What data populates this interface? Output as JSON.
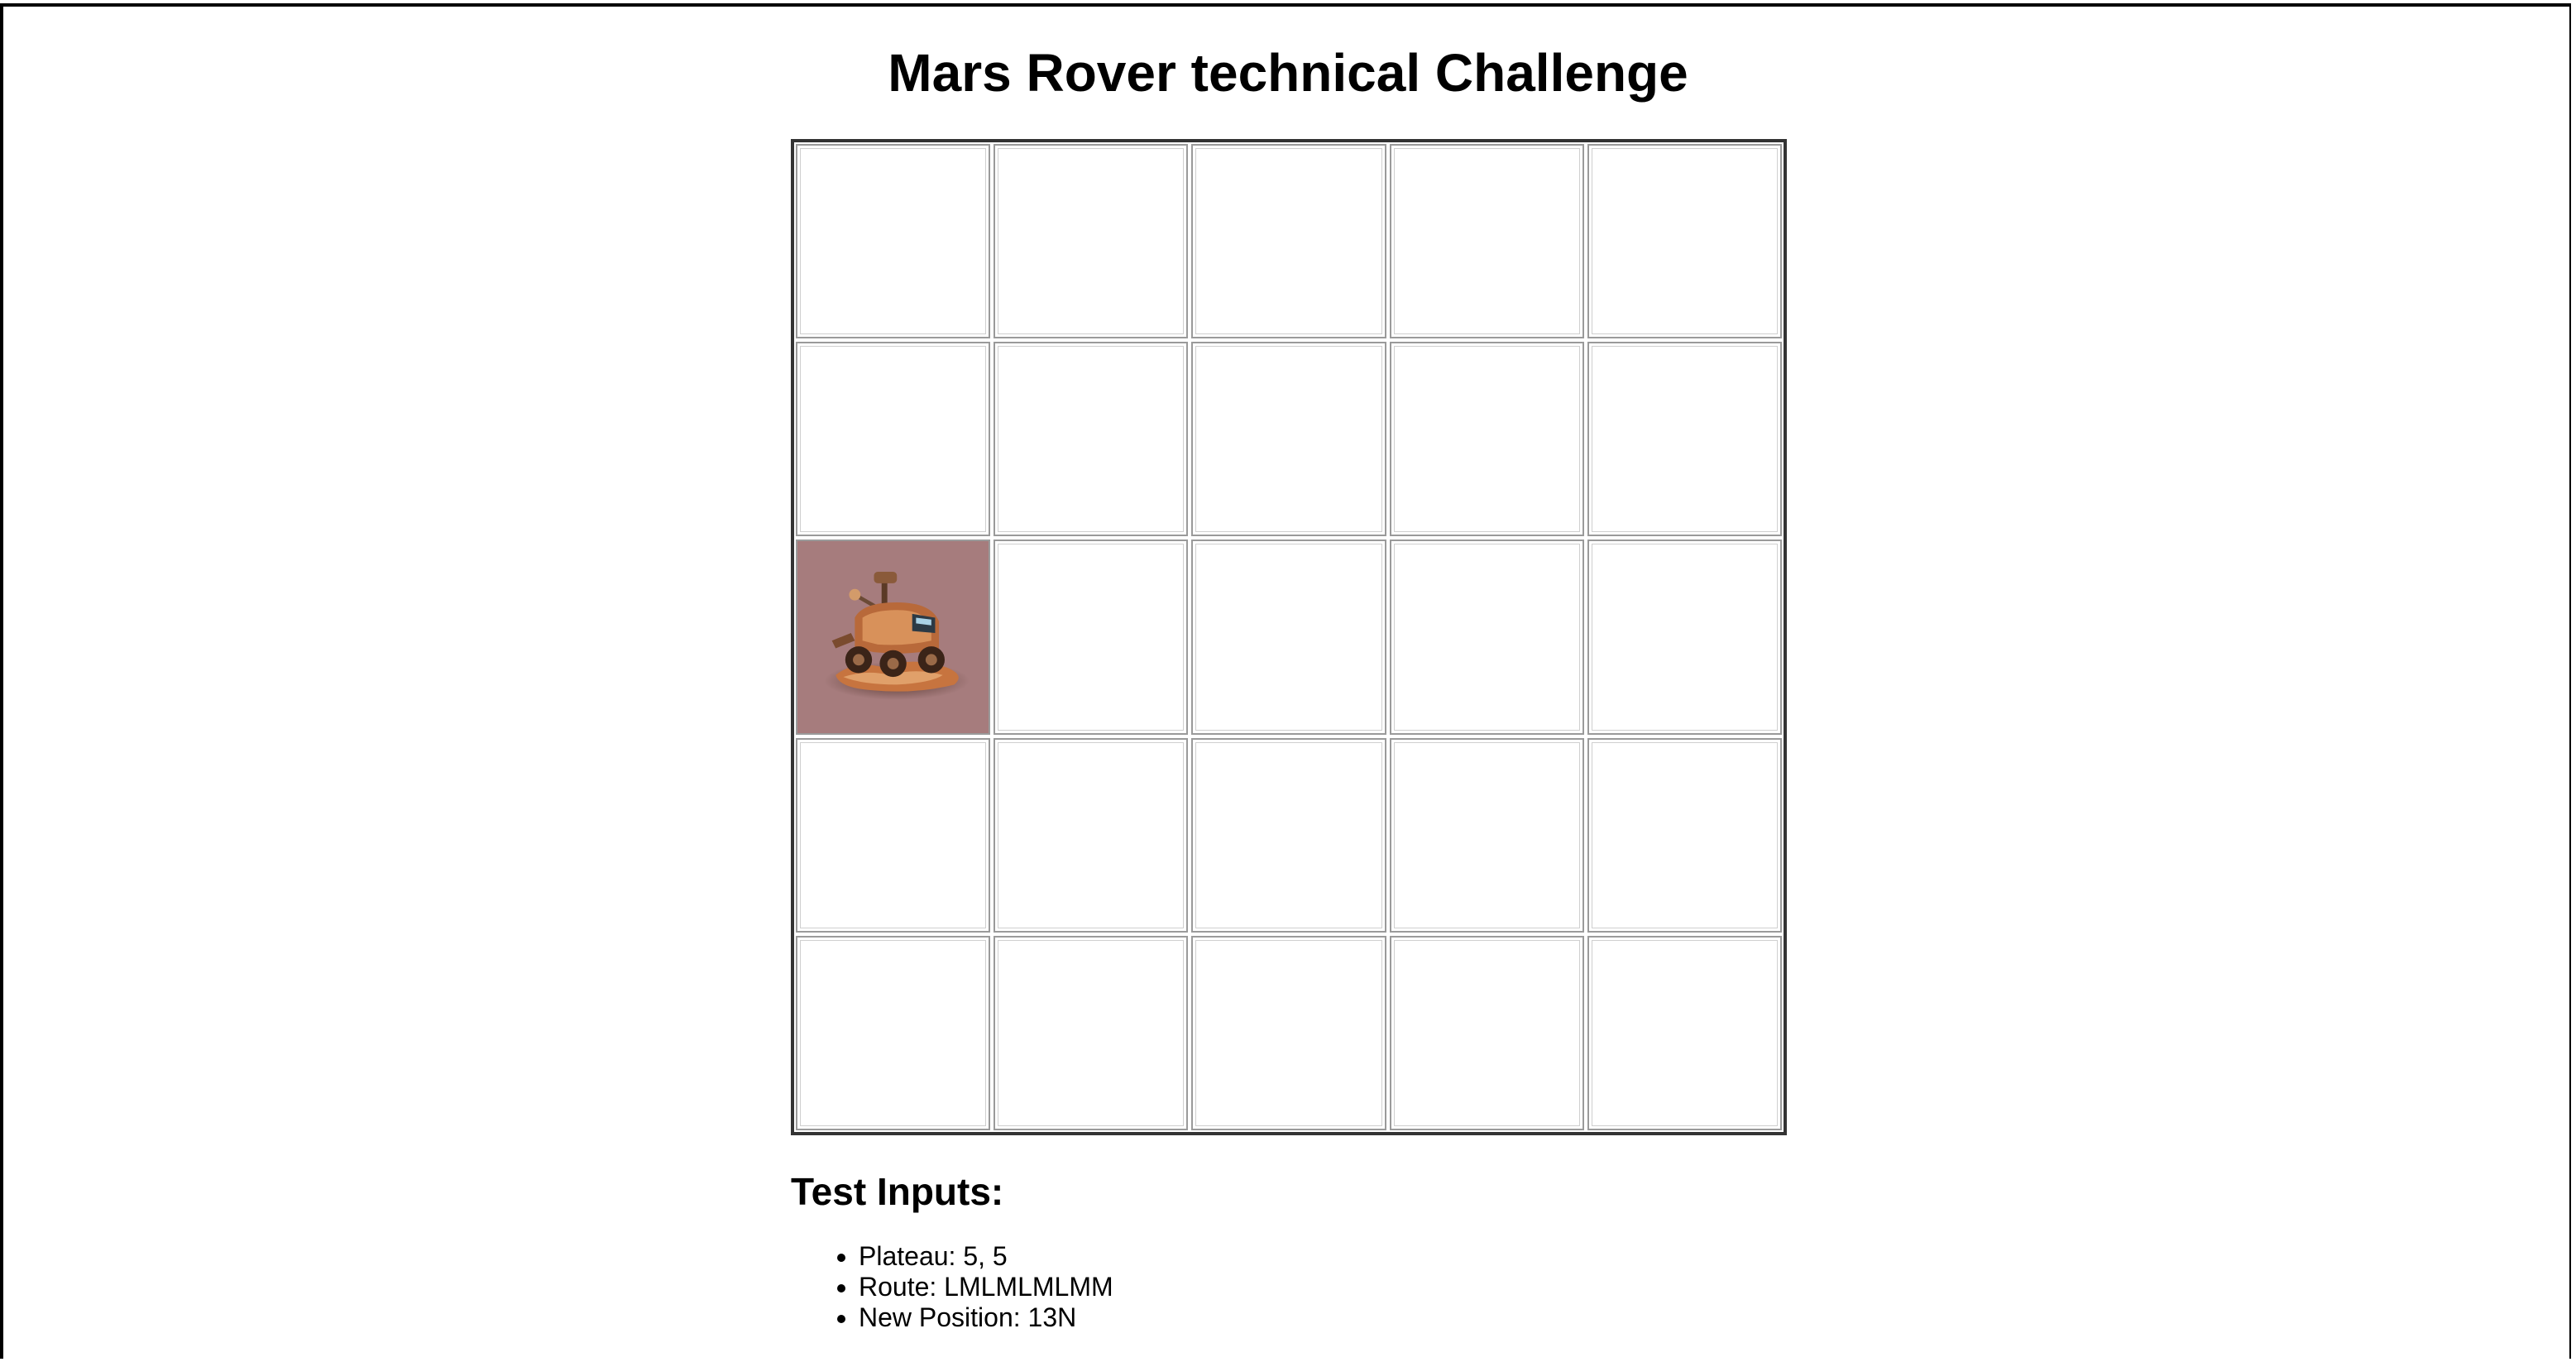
{
  "page": {
    "title": "Mars Rover technical Challenge"
  },
  "plateau_grid": {
    "columns": 5,
    "rows": 5,
    "rover_cell": {
      "row": 3,
      "column": 1
    },
    "rover_icon": "mars-rover-icon",
    "colors": {
      "occupied_cell": "#a67c7d",
      "cell_border": "#9a9a9a",
      "grid_border": "#333333"
    }
  },
  "test_inputs": {
    "heading": "Test Inputs:",
    "items": [
      {
        "label": "Plateau: 5, 5"
      },
      {
        "label": "Route: LMLMLMLMM"
      },
      {
        "label": "New Position: 13N"
      }
    ]
  }
}
